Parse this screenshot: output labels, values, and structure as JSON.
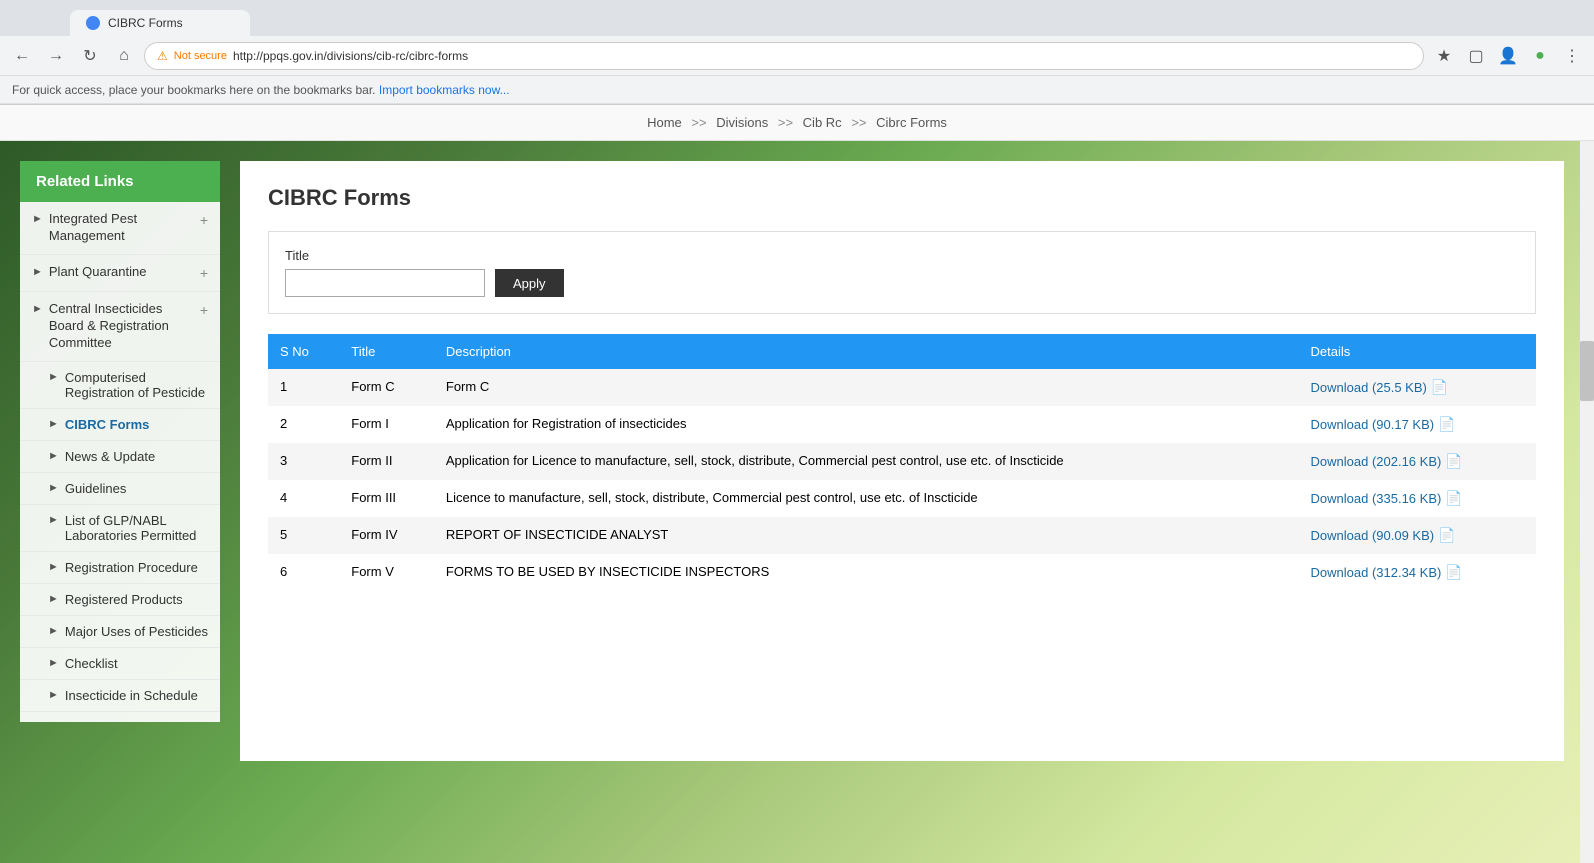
{
  "browser": {
    "url": "http://ppqs.gov.in/divisions/cib-rc/cibrc-forms",
    "not_secure_label": "Not secure",
    "tab_title": "CIBRC Forms"
  },
  "bookmarks_bar": {
    "text": "For quick access, place your bookmarks here on the bookmarks bar.",
    "link_text": "Import bookmarks now..."
  },
  "breadcrumb": {
    "items": [
      "Home",
      "Divisions",
      "Cib Rc",
      "Cibrc Forms"
    ],
    "separators": [
      ">>",
      ">>",
      ">>"
    ]
  },
  "sidebar": {
    "header": "Related Links",
    "items": [
      {
        "label": "Integrated Pest Management",
        "has_plus": true,
        "is_sub": false
      },
      {
        "label": "Plant Quarantine",
        "has_plus": true,
        "is_sub": false
      },
      {
        "label": "Central Insecticides Board & Registration Committee",
        "has_plus": true,
        "is_sub": false
      },
      {
        "label": "Computerised Registration of Pesticide",
        "is_sub": true
      },
      {
        "label": "CIBRC Forms",
        "is_sub": true,
        "is_active": true
      },
      {
        "label": "News & Update",
        "is_sub": true
      },
      {
        "label": "Guidelines",
        "is_sub": true
      },
      {
        "label": "List of GLP/NABL Laboratories Permitted",
        "is_sub": true
      },
      {
        "label": "Registration Procedure",
        "is_sub": true
      },
      {
        "label": "Registered Products",
        "is_sub": true
      },
      {
        "label": "Major Uses of Pesticides",
        "is_sub": true
      },
      {
        "label": "Checklist",
        "is_sub": true
      },
      {
        "label": "Insecticide in Schedule",
        "is_sub": true
      }
    ]
  },
  "main": {
    "page_title": "CIBRC Forms",
    "filter": {
      "label": "Title",
      "input_placeholder": "",
      "apply_button": "Apply"
    },
    "table": {
      "headers": [
        "S No",
        "Title",
        "Description",
        "Details"
      ],
      "rows": [
        {
          "sno": "1",
          "title": "Form C",
          "description": "Form C",
          "details_label": "Download (25.5 KB)"
        },
        {
          "sno": "2",
          "title": "Form I",
          "description": "Application for Registration of insecticides",
          "details_label": "Download (90.17 KB)"
        },
        {
          "sno": "3",
          "title": "Form II",
          "description": "Application for Licence to manufacture, sell, stock, distribute, Commercial pest control, use etc. of Inscticide",
          "details_label": "Download (202.16 KB)"
        },
        {
          "sno": "4",
          "title": "Form III",
          "description": "Licence to manufacture, sell, stock, distribute, Commercial pest control, use etc. of Inscticide",
          "details_label": "Download (335.16 KB)"
        },
        {
          "sno": "5",
          "title": "Form IV",
          "description": "REPORT OF INSECTICIDE ANALYST",
          "details_label": "Download (90.09 KB)"
        },
        {
          "sno": "6",
          "title": "Form V",
          "description": "FORMS TO BE USED BY INSECTICIDE INSPECTORS",
          "details_label": "Download (312.34 KB)"
        }
      ]
    }
  }
}
